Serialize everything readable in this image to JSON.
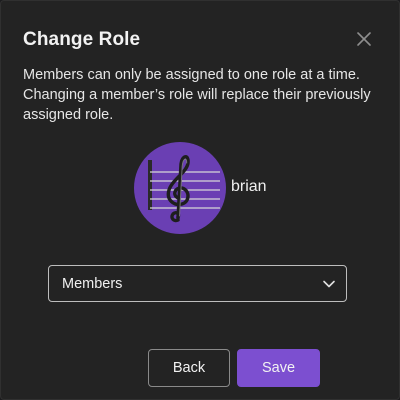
{
  "dialog": {
    "title": "Change Role",
    "description": "Members can only be assigned to one role at a time. Changing a member’s role will replace their previously assigned role.",
    "close_icon": "close-icon"
  },
  "user": {
    "name": "brian",
    "avatar_icon": "treble-clef-avatar"
  },
  "role_select": {
    "selected": "Members",
    "icon": "chevron-down-icon"
  },
  "buttons": {
    "back_label": "Back",
    "save_label": "Save"
  },
  "colors": {
    "accent": "#7c4fd0",
    "avatar_bg": "#6a3fb3",
    "background": "#232323"
  }
}
